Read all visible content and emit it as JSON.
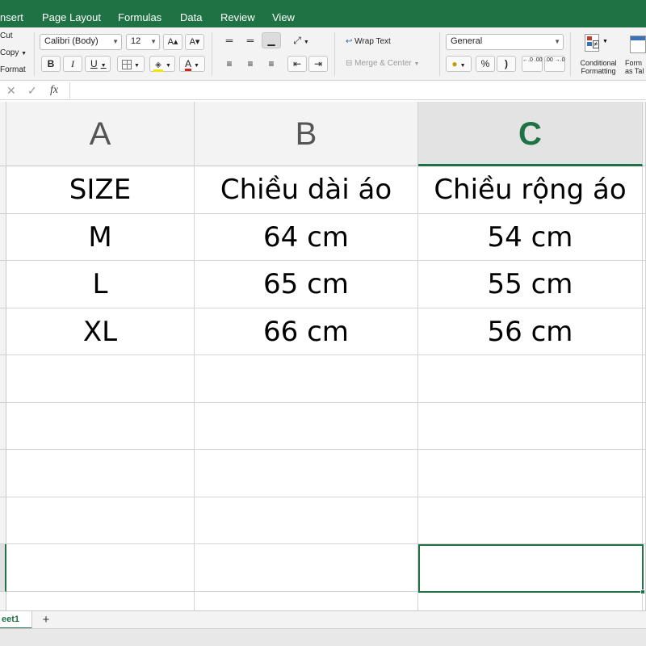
{
  "ribbon_tabs": [
    "nsert",
    "Page Layout",
    "Formulas",
    "Data",
    "Review",
    "View"
  ],
  "clipboard": {
    "cut": "Cut",
    "copy": "Copy",
    "format": "Format"
  },
  "font": {
    "name": "Calibri (Body)",
    "size": "12",
    "bold": "B",
    "italic": "I",
    "underline": "U",
    "grow": "A▴",
    "shrink": "A▾",
    "font_color_glyph": "A"
  },
  "alignment": {
    "wrap_text": "Wrap Text",
    "merge_center": "Merge & Center"
  },
  "number": {
    "format": "General",
    "percent": "%",
    "comma": ")",
    "inc_decimal": "←.0 .00",
    "dec_decimal": ".00 →.0"
  },
  "styles": {
    "conditional_1": "Conditional",
    "conditional_2": "Formatting",
    "format_table_1": "Form",
    "format_table_2": "as Tal"
  },
  "formula_bar": {
    "cancel": "✕",
    "enter": "✓",
    "fx": "fx",
    "content": ""
  },
  "columns": [
    {
      "letter": "A",
      "active": false
    },
    {
      "letter": "B",
      "active": false
    },
    {
      "letter": "C",
      "active": true
    }
  ],
  "rows": [
    [
      "SIZE",
      "Chiều dài áo",
      "Chiều rộng áo"
    ],
    [
      "M",
      "64 cm",
      "54 cm"
    ],
    [
      "L",
      "65 cm",
      "55 cm"
    ],
    [
      "XL",
      "66 cm",
      "56 cm"
    ],
    [
      "",
      "",
      ""
    ],
    [
      "",
      "",
      ""
    ],
    [
      "",
      "",
      ""
    ],
    [
      "",
      "",
      ""
    ],
    [
      "",
      "",
      ""
    ],
    [
      "",
      "",
      ""
    ]
  ],
  "selected_cell": "C9",
  "sheet_tabs": [
    "eet1"
  ],
  "add_sheet": "+",
  "colors": {
    "accent": "#1f7244",
    "grid_line": "#d4d4d4",
    "header_bg": "#f3f3f3"
  }
}
